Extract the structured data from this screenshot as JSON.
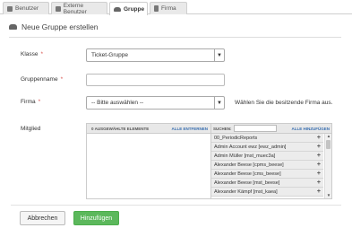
{
  "tabs": [
    {
      "label": "Benutzer",
      "icon": "user-icon",
      "active": false
    },
    {
      "label": "Externe Benutzer",
      "icon": "user-icon",
      "active": false
    },
    {
      "label": "Gruppe",
      "icon": "group-icon",
      "active": true
    },
    {
      "label": "Firma",
      "icon": "building-icon",
      "active": false
    }
  ],
  "header": {
    "title": "Neue Gruppe erstellen",
    "icon": "group-icon"
  },
  "form": {
    "klasse": {
      "label": "Klasse",
      "value": "Ticket-Gruppe"
    },
    "gruppenname": {
      "label": "Gruppenname",
      "value": ""
    },
    "firma": {
      "label": "Firma",
      "value": "-- Bitte auswählen --",
      "hint": "Wählen Sie die besitzende Firma aus."
    },
    "mitglied": {
      "label": "Mitglied"
    }
  },
  "multiselect": {
    "selected_count_label": "0 AUSGEWÄHLTE ELEMENTE",
    "remove_all": "ALLE ENTFERNEN",
    "search_label": "SUCHEN:",
    "search_value": "",
    "add_all": "ALLE HINZUFÜGEN",
    "items": [
      "00_PeriodicReports",
      "Admin Account ewz [ewz_admin]",
      "Admin Müller [mst_muec3a]",
      "Alexander Beese [cpms_beese]",
      "Alexander Beese [cms_beese]",
      "Alexander Beese [mst_beese]",
      "Alexander Kämpf [mst_kaea]"
    ]
  },
  "buttons": {
    "cancel": "Abbrechen",
    "add": "Hinzufügen"
  },
  "colors": {
    "primary_button": "#5cb85c",
    "required": "#d9534f",
    "link": "#3a6fb0"
  }
}
